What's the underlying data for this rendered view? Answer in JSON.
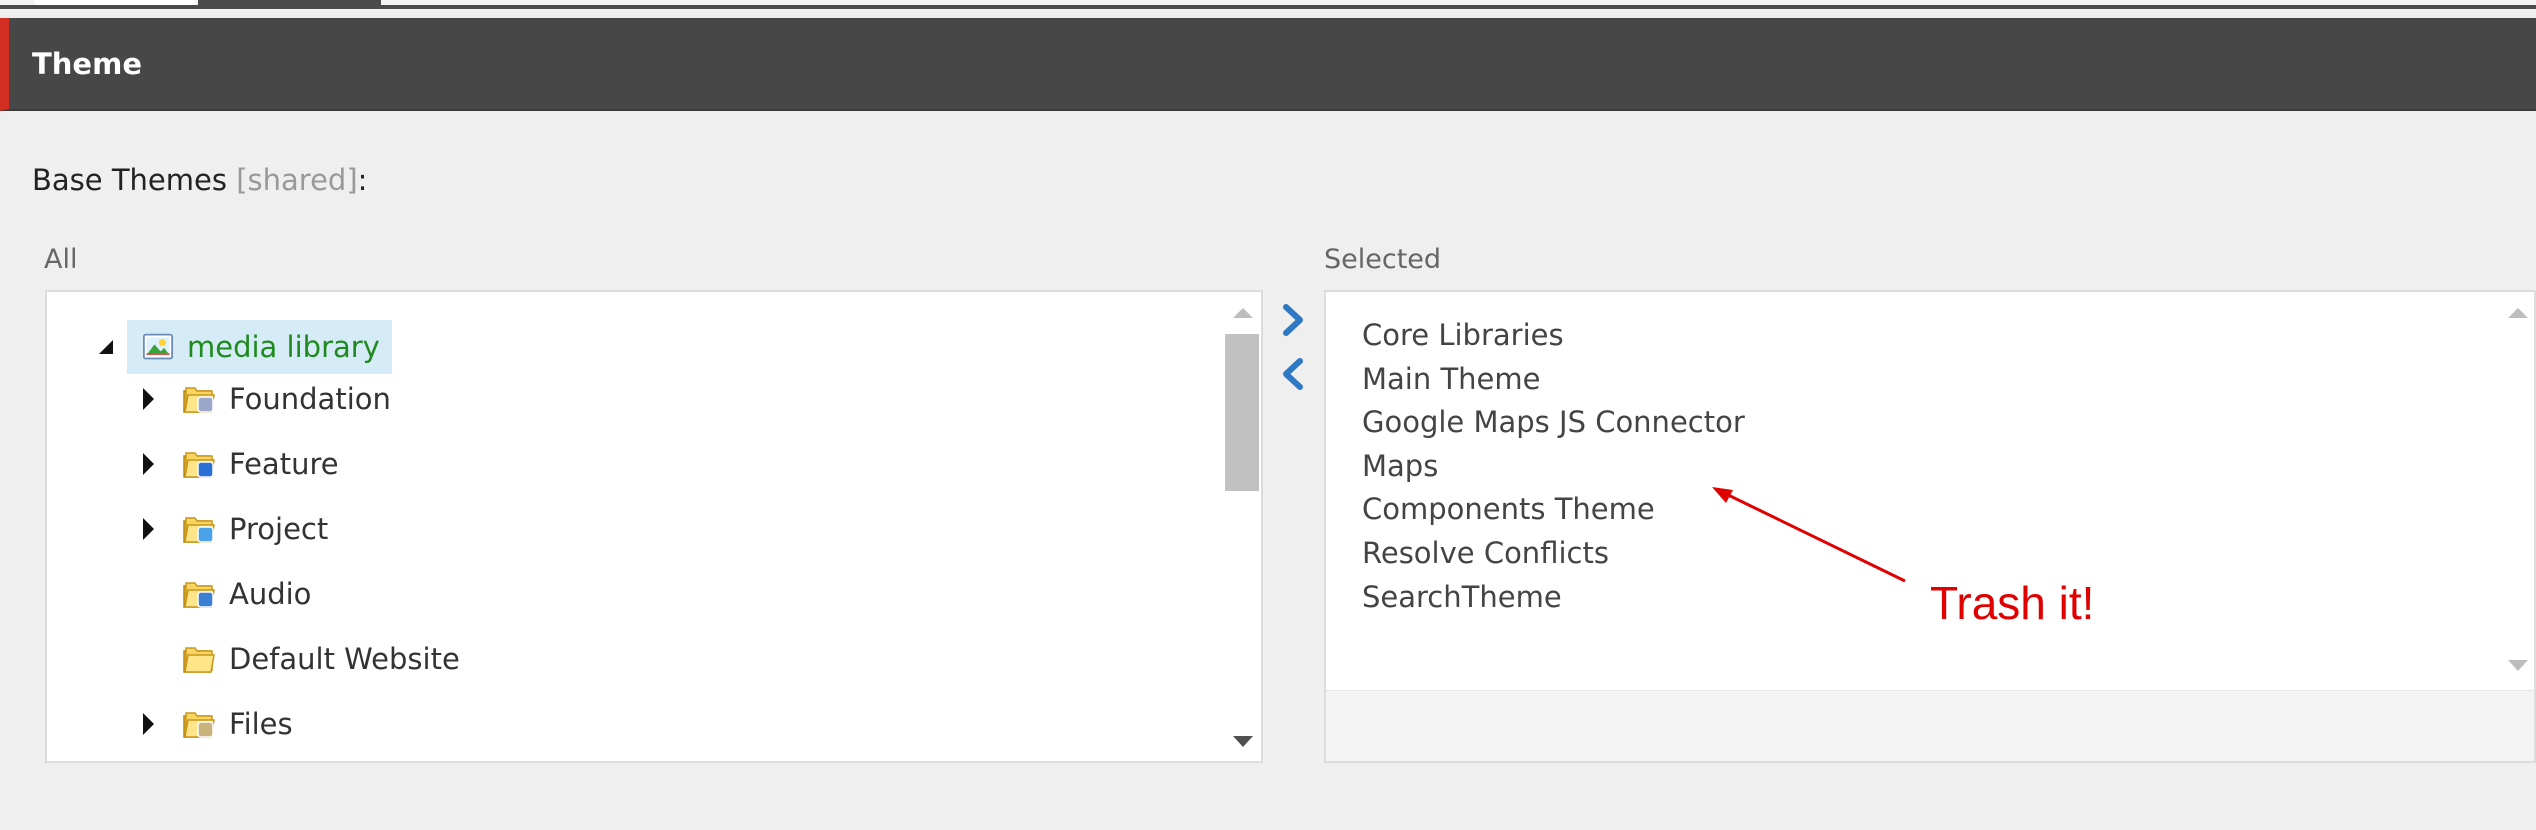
{
  "section": {
    "title": "Theme"
  },
  "field": {
    "label": "Base Themes",
    "shared_tag": "[shared]",
    "suffix": ":"
  },
  "all_column": {
    "label": "All",
    "tree": {
      "root": {
        "label": "media library",
        "icon": "media-library-icon",
        "expanded": true
      },
      "items": [
        {
          "label": "Foundation",
          "icon": "folder-gear-icon",
          "expandable": true
        },
        {
          "label": "Feature",
          "icon": "folder-feature-icon",
          "expandable": true
        },
        {
          "label": "Project",
          "icon": "folder-project-icon",
          "expandable": true
        },
        {
          "label": "Audio",
          "icon": "folder-audio-icon",
          "expandable": false
        },
        {
          "label": "Default Website",
          "icon": "folder-icon",
          "expandable": false
        },
        {
          "label": "Files",
          "icon": "folder-files-icon",
          "expandable": true
        }
      ]
    }
  },
  "selected_column": {
    "label": "Selected",
    "items": [
      "Core Libraries",
      "Main Theme",
      "Google Maps JS Connector",
      "Maps",
      "Components Theme",
      "Resolve Conflicts",
      "SearchTheme"
    ]
  },
  "buttons": {
    "add_icon": "chevron-right-icon",
    "remove_icon": "chevron-left-icon"
  },
  "annotation": {
    "text": "Trash it!",
    "color": "#e00000"
  },
  "colors": {
    "header_bg": "#474747",
    "header_accent": "#d22e22",
    "tree_selected_bg": "#d5ebf5",
    "tree_selected_text": "#1f8a1f",
    "move_button": "#2f78c4"
  }
}
